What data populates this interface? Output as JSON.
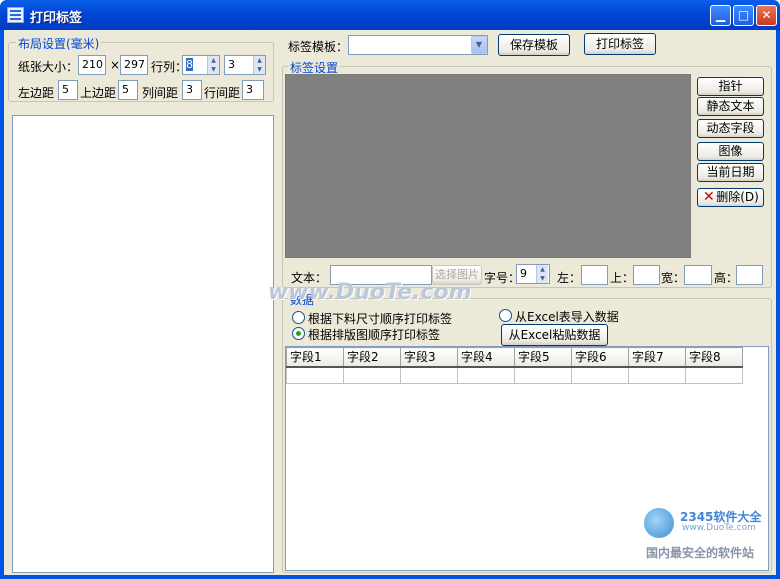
{
  "window": {
    "title": "打印标签"
  },
  "layout_group": {
    "title": "布局设置(毫米)",
    "paper_label": "纸张大小：",
    "paper_width": "210",
    "times": "×",
    "paper_height": "297",
    "rows_cols_label": "行列：",
    "rows": "8",
    "cols": "3",
    "left_margin_label": "左边距",
    "left_margin": "5",
    "top_margin_label": "上边距",
    "top_margin": "5",
    "col_gap_label": "列间距",
    "col_gap": "3",
    "row_gap_label": "行间距",
    "row_gap": "3"
  },
  "template_bar": {
    "label": "标签模板：",
    "value": "",
    "save_label": "保存模板",
    "print_label": "打印标签"
  },
  "label_settings": {
    "title": "标签设置",
    "tools": [
      "指针",
      "静态文本",
      "动态字段",
      "图像",
      "当前日期"
    ],
    "delete_label": "删除(D)"
  },
  "props": {
    "text_label": "文本：",
    "text_value": "",
    "select_image_label": "选择图片",
    "font_size_label": "字号：",
    "font_size": "9",
    "left_label": "左：",
    "top_label": "上：",
    "width_label": "宽：",
    "height_label": "高："
  },
  "data_group": {
    "title": "数据",
    "option1": "根据下料尺寸顺序打印标签",
    "option2": "根据排版图顺序打印标签",
    "option3": "从Excel表导入数据",
    "paste_label": "从Excel粘贴数据",
    "columns": [
      "字段1",
      "字段2",
      "字段3",
      "字段4",
      "字段5",
      "字段6",
      "字段7",
      "字段8"
    ]
  },
  "watermarks": {
    "center": "www.DuoTe.com",
    "corner_brand": "2345软件大全",
    "corner_url": "www.DuoTe.com",
    "corner_slogan": "国内最安全的软件站"
  }
}
